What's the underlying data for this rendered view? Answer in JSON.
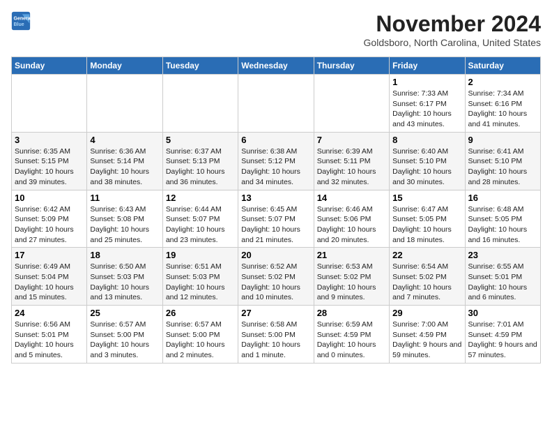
{
  "logo": {
    "line1": "General",
    "line2": "Blue"
  },
  "title": "November 2024",
  "location": "Goldsboro, North Carolina, United States",
  "days_of_week": [
    "Sunday",
    "Monday",
    "Tuesday",
    "Wednesday",
    "Thursday",
    "Friday",
    "Saturday"
  ],
  "weeks": [
    [
      {
        "day": "",
        "info": ""
      },
      {
        "day": "",
        "info": ""
      },
      {
        "day": "",
        "info": ""
      },
      {
        "day": "",
        "info": ""
      },
      {
        "day": "",
        "info": ""
      },
      {
        "day": "1",
        "info": "Sunrise: 7:33 AM\nSunset: 6:17 PM\nDaylight: 10 hours and 43 minutes."
      },
      {
        "day": "2",
        "info": "Sunrise: 7:34 AM\nSunset: 6:16 PM\nDaylight: 10 hours and 41 minutes."
      }
    ],
    [
      {
        "day": "3",
        "info": "Sunrise: 6:35 AM\nSunset: 5:15 PM\nDaylight: 10 hours and 39 minutes."
      },
      {
        "day": "4",
        "info": "Sunrise: 6:36 AM\nSunset: 5:14 PM\nDaylight: 10 hours and 38 minutes."
      },
      {
        "day": "5",
        "info": "Sunrise: 6:37 AM\nSunset: 5:13 PM\nDaylight: 10 hours and 36 minutes."
      },
      {
        "day": "6",
        "info": "Sunrise: 6:38 AM\nSunset: 5:12 PM\nDaylight: 10 hours and 34 minutes."
      },
      {
        "day": "7",
        "info": "Sunrise: 6:39 AM\nSunset: 5:11 PM\nDaylight: 10 hours and 32 minutes."
      },
      {
        "day": "8",
        "info": "Sunrise: 6:40 AM\nSunset: 5:10 PM\nDaylight: 10 hours and 30 minutes."
      },
      {
        "day": "9",
        "info": "Sunrise: 6:41 AM\nSunset: 5:10 PM\nDaylight: 10 hours and 28 minutes."
      }
    ],
    [
      {
        "day": "10",
        "info": "Sunrise: 6:42 AM\nSunset: 5:09 PM\nDaylight: 10 hours and 27 minutes."
      },
      {
        "day": "11",
        "info": "Sunrise: 6:43 AM\nSunset: 5:08 PM\nDaylight: 10 hours and 25 minutes."
      },
      {
        "day": "12",
        "info": "Sunrise: 6:44 AM\nSunset: 5:07 PM\nDaylight: 10 hours and 23 minutes."
      },
      {
        "day": "13",
        "info": "Sunrise: 6:45 AM\nSunset: 5:07 PM\nDaylight: 10 hours and 21 minutes."
      },
      {
        "day": "14",
        "info": "Sunrise: 6:46 AM\nSunset: 5:06 PM\nDaylight: 10 hours and 20 minutes."
      },
      {
        "day": "15",
        "info": "Sunrise: 6:47 AM\nSunset: 5:05 PM\nDaylight: 10 hours and 18 minutes."
      },
      {
        "day": "16",
        "info": "Sunrise: 6:48 AM\nSunset: 5:05 PM\nDaylight: 10 hours and 16 minutes."
      }
    ],
    [
      {
        "day": "17",
        "info": "Sunrise: 6:49 AM\nSunset: 5:04 PM\nDaylight: 10 hours and 15 minutes."
      },
      {
        "day": "18",
        "info": "Sunrise: 6:50 AM\nSunset: 5:03 PM\nDaylight: 10 hours and 13 minutes."
      },
      {
        "day": "19",
        "info": "Sunrise: 6:51 AM\nSunset: 5:03 PM\nDaylight: 10 hours and 12 minutes."
      },
      {
        "day": "20",
        "info": "Sunrise: 6:52 AM\nSunset: 5:02 PM\nDaylight: 10 hours and 10 minutes."
      },
      {
        "day": "21",
        "info": "Sunrise: 6:53 AM\nSunset: 5:02 PM\nDaylight: 10 hours and 9 minutes."
      },
      {
        "day": "22",
        "info": "Sunrise: 6:54 AM\nSunset: 5:02 PM\nDaylight: 10 hours and 7 minutes."
      },
      {
        "day": "23",
        "info": "Sunrise: 6:55 AM\nSunset: 5:01 PM\nDaylight: 10 hours and 6 minutes."
      }
    ],
    [
      {
        "day": "24",
        "info": "Sunrise: 6:56 AM\nSunset: 5:01 PM\nDaylight: 10 hours and 5 minutes."
      },
      {
        "day": "25",
        "info": "Sunrise: 6:57 AM\nSunset: 5:00 PM\nDaylight: 10 hours and 3 minutes."
      },
      {
        "day": "26",
        "info": "Sunrise: 6:57 AM\nSunset: 5:00 PM\nDaylight: 10 hours and 2 minutes."
      },
      {
        "day": "27",
        "info": "Sunrise: 6:58 AM\nSunset: 5:00 PM\nDaylight: 10 hours and 1 minute."
      },
      {
        "day": "28",
        "info": "Sunrise: 6:59 AM\nSunset: 4:59 PM\nDaylight: 10 hours and 0 minutes."
      },
      {
        "day": "29",
        "info": "Sunrise: 7:00 AM\nSunset: 4:59 PM\nDaylight: 9 hours and 59 minutes."
      },
      {
        "day": "30",
        "info": "Sunrise: 7:01 AM\nSunset: 4:59 PM\nDaylight: 9 hours and 57 minutes."
      }
    ]
  ]
}
